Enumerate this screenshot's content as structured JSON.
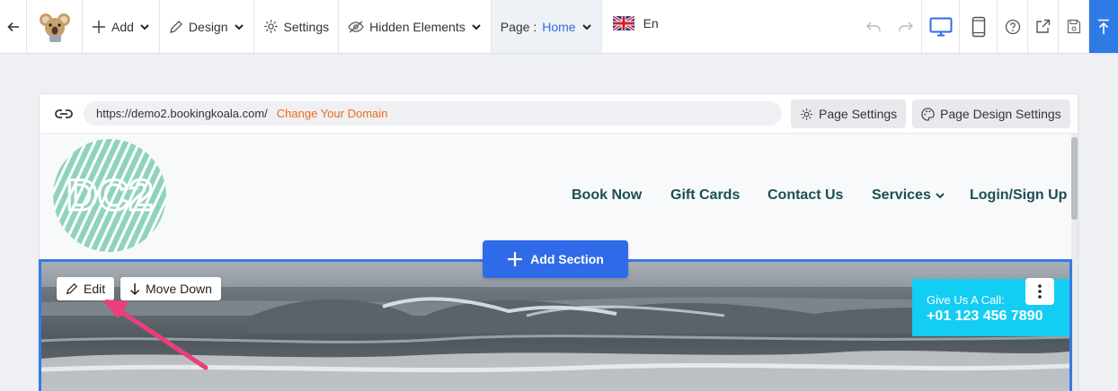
{
  "toolbar": {
    "add_label": "Add",
    "design_label": "Design",
    "settings_label": "Settings",
    "hidden_label": "Hidden Elements",
    "page_prefix": "Page :",
    "page_value": "Home",
    "lang_label": "En",
    "publish_color": "#2f7be6"
  },
  "url_bar": {
    "url": "https://demo2.bookingkoala.com/",
    "change_domain": "Change Your Domain",
    "page_settings": "Page Settings",
    "page_design_settings": "Page Design Settings"
  },
  "site": {
    "logo_text": "DC2",
    "nav": [
      "Book Now",
      "Gift Cards",
      "Contact Us",
      "Services",
      "Login/Sign Up"
    ]
  },
  "editor": {
    "add_section": "Add Section",
    "edit": "Edit",
    "move_down": "Move Down"
  },
  "callout": {
    "label": "Give Us A Call:",
    "phone": "+01 123 456 7890"
  },
  "colors": {
    "accent": "#2f6be9",
    "nav_text": "#1c4f52",
    "call_bg": "#14cdf2",
    "domain_link": "#ef6a1d",
    "annotation_arrow": "#ee3d78"
  }
}
